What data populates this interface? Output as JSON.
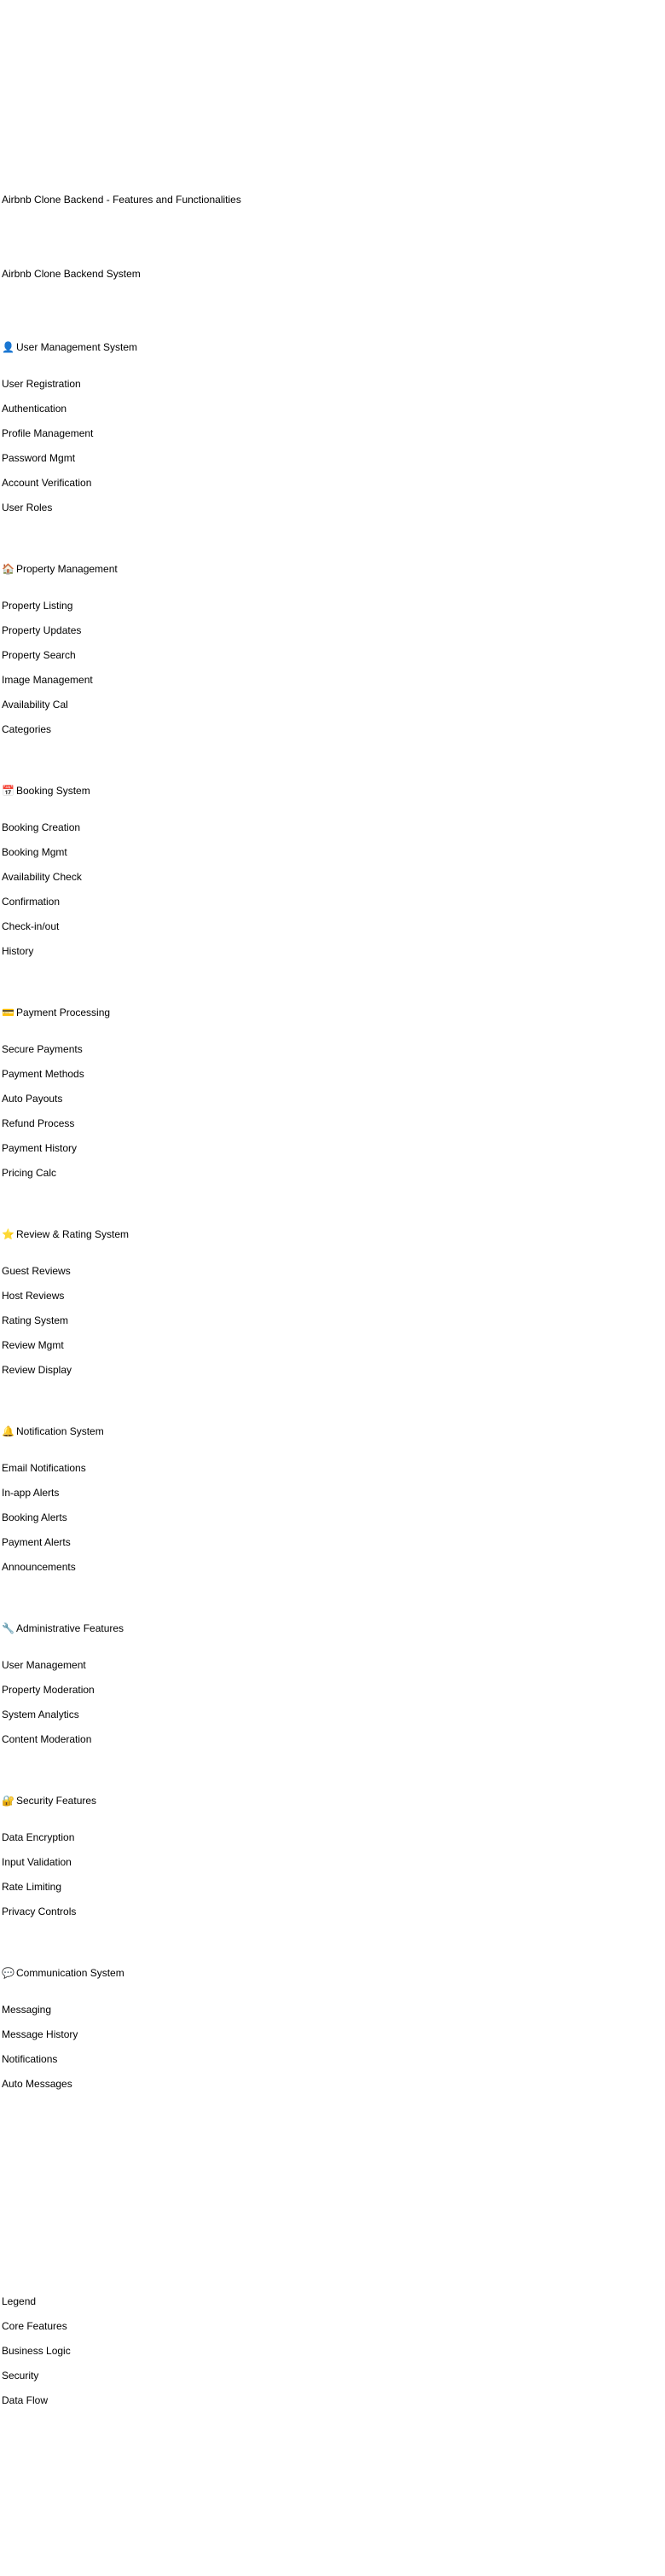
{
  "title": "Airbnb Clone Backend - Features and Functionalities",
  "system_title": "Airbnb Clone Backend System",
  "sections": [
    {
      "icon": "user-icon",
      "glyph": "👤",
      "title": "User Management System",
      "items": [
        "User Registration",
        "Authentication",
        "Profile Management",
        "Password Mgmt",
        "Account Verification",
        "User Roles"
      ]
    },
    {
      "icon": "house-icon",
      "glyph": "🏠",
      "title": "Property Management",
      "items": [
        "Property Listing",
        "Property Updates",
        "Property Search",
        "Image Management",
        "Availability Cal",
        "Categories"
      ]
    },
    {
      "icon": "calendar-icon",
      "glyph": "📅",
      "title": "Booking System",
      "items": [
        "Booking Creation",
        "Booking Mgmt",
        "Availability Check",
        "Confirmation",
        "Check-in/out",
        "History"
      ]
    },
    {
      "icon": "credit-card-icon",
      "glyph": "💳",
      "title": "Payment Processing",
      "items": [
        "Secure Payments",
        "Payment Methods",
        "Auto Payouts",
        "Refund Process",
        "Payment History",
        "Pricing Calc"
      ]
    },
    {
      "icon": "star-icon",
      "glyph": "⭐",
      "title": "Review & Rating System",
      "items": [
        "Guest Reviews",
        "Host Reviews",
        "Rating System",
        "Review Mgmt",
        "Review Display"
      ]
    },
    {
      "icon": "bell-icon",
      "glyph": "🔔",
      "title": "Notification System",
      "items": [
        "Email Notifications",
        "In-app Alerts",
        "Booking Alerts",
        "Payment Alerts",
        "Announcements"
      ]
    },
    {
      "icon": "wrench-icon",
      "glyph": "🔧",
      "title": "Administrative Features",
      "items": [
        "User Management",
        "Property Moderation",
        "System Analytics",
        "Content Moderation"
      ]
    },
    {
      "icon": "lock-icon",
      "glyph": "🔐",
      "title": "Security Features",
      "items": [
        "Data Encryption",
        "Input Validation",
        "Rate Limiting",
        "Privacy Controls"
      ]
    },
    {
      "icon": "speech-bubble-icon",
      "glyph": "💬",
      "title": "Communication System",
      "items": [
        "Messaging",
        "Message History",
        "Notifications",
        "Auto Messages"
      ]
    }
  ],
  "legend": {
    "title": "Legend",
    "items": [
      "Core Features",
      "Business Logic",
      "Security",
      "Data Flow"
    ]
  }
}
